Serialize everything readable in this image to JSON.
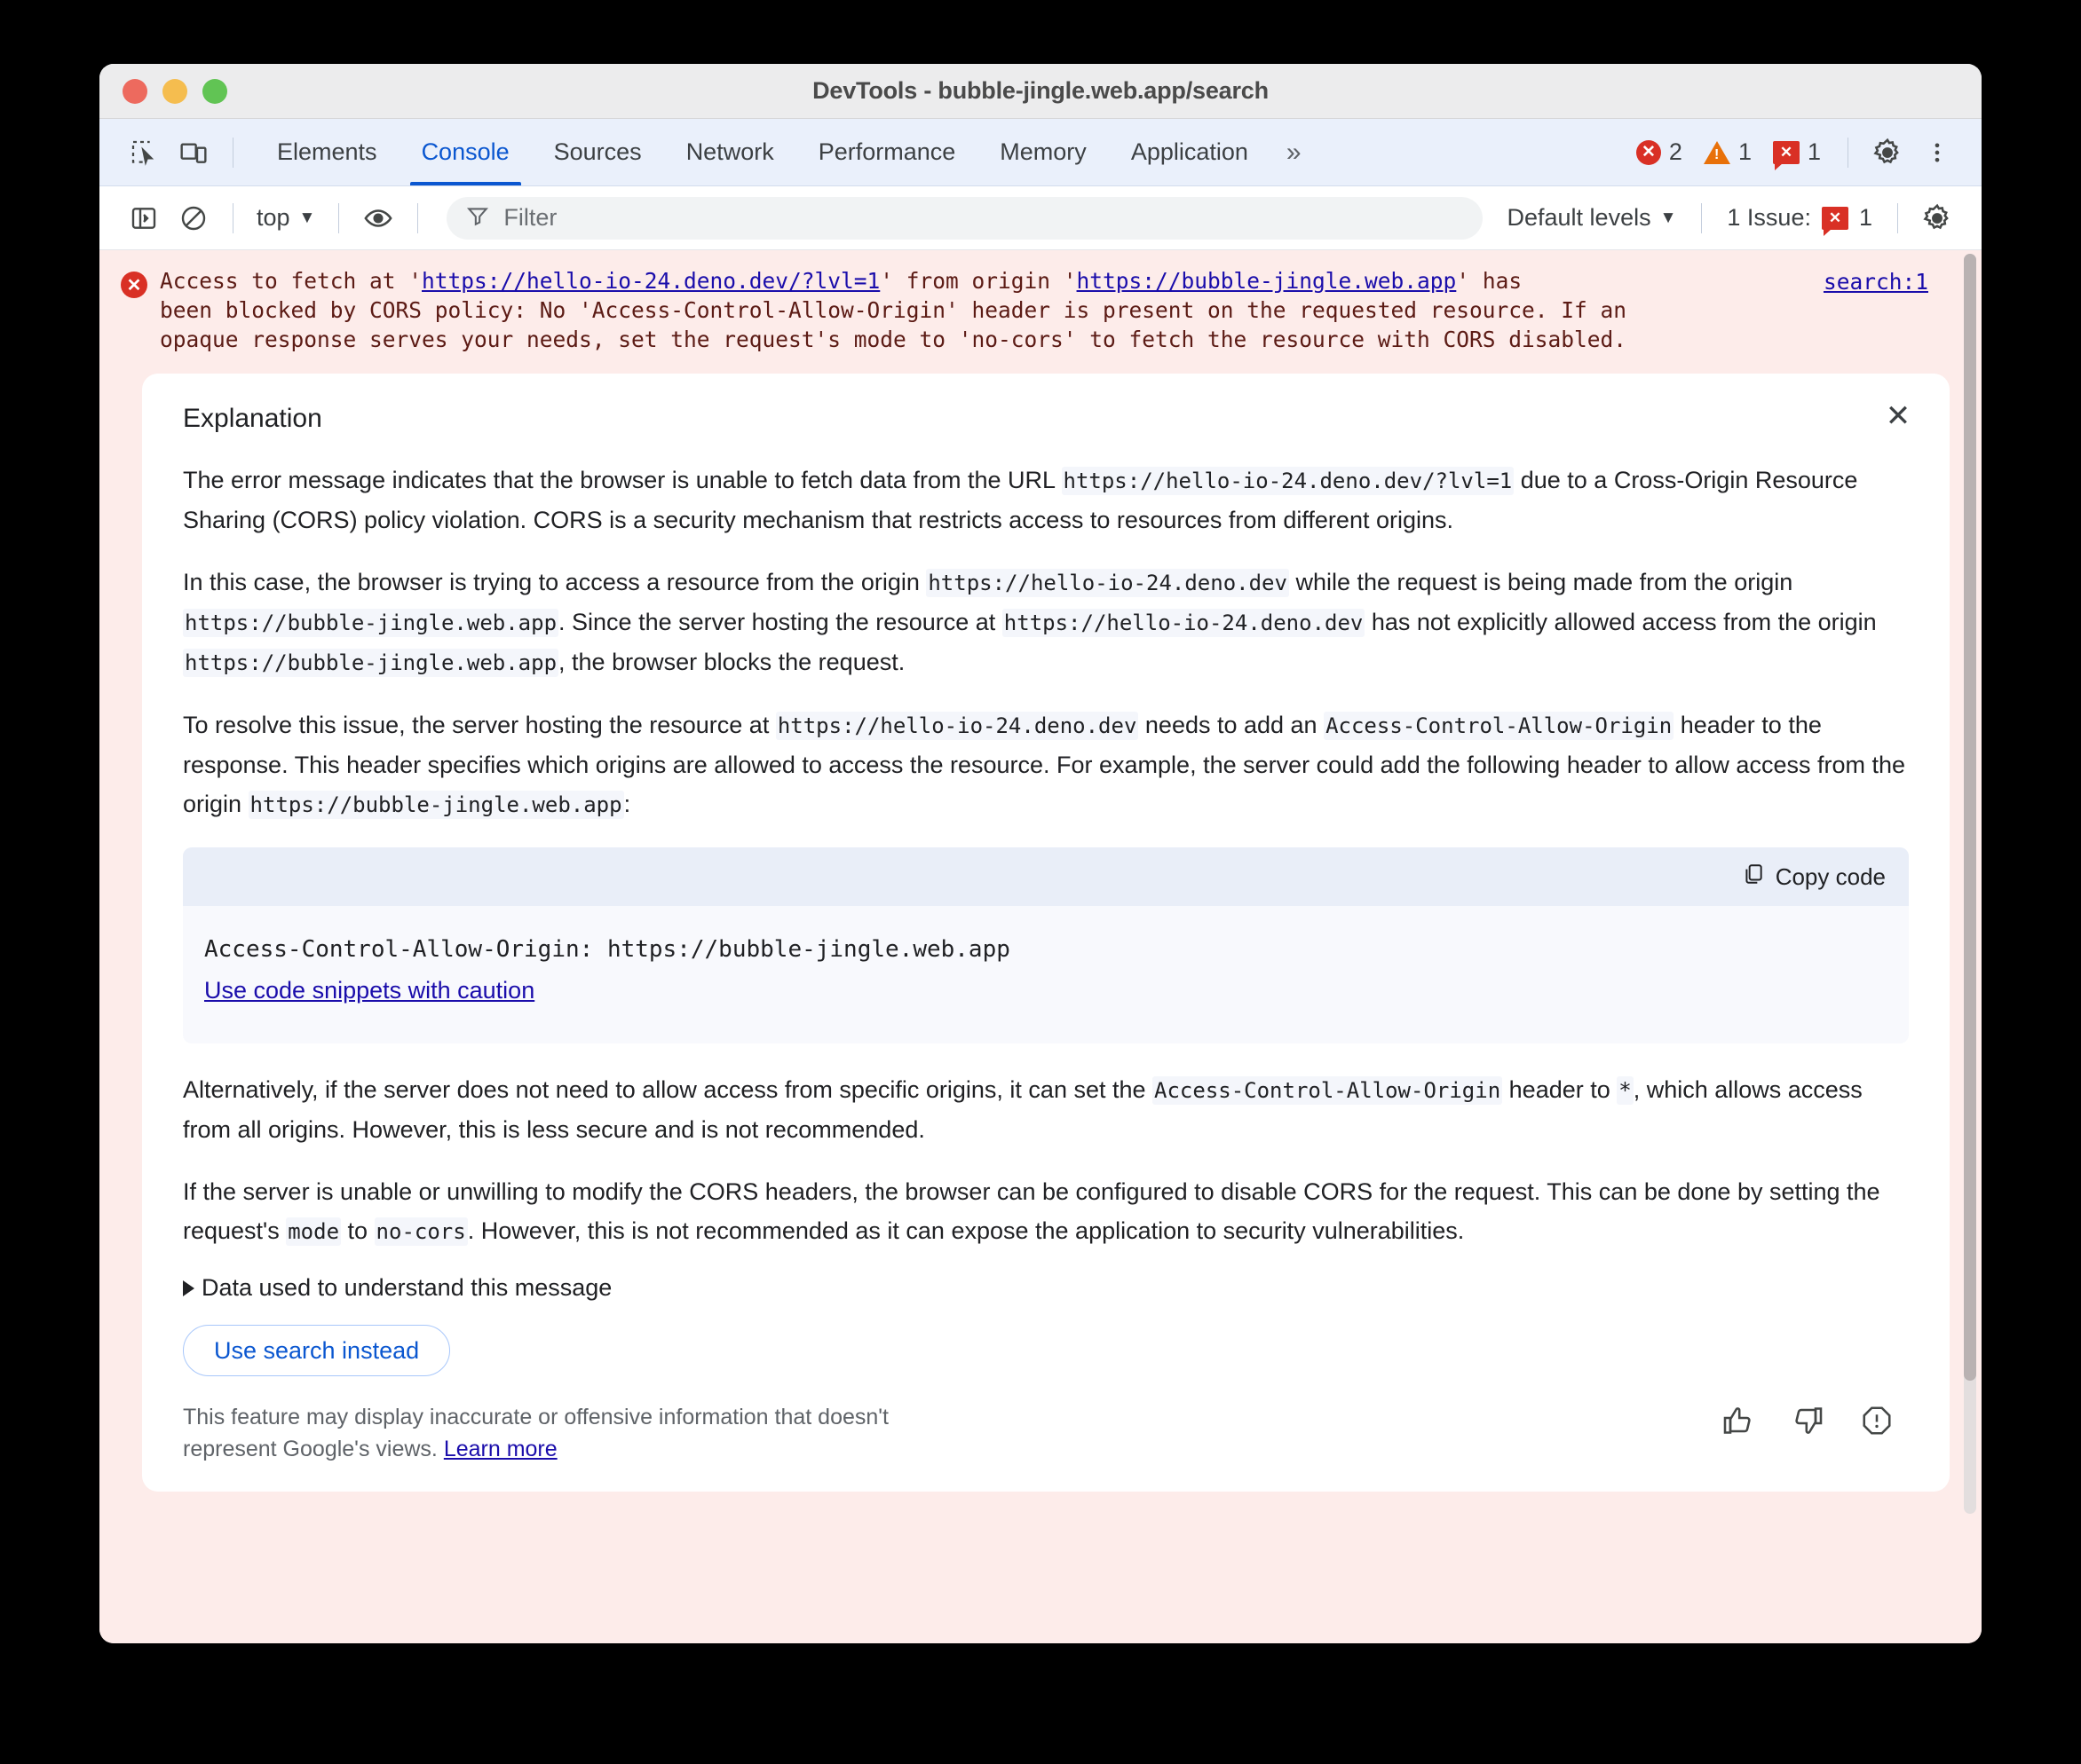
{
  "window": {
    "title": "DevTools - bubble-jingle.web.app/search",
    "traffic_lights": [
      "close",
      "minimize",
      "maximize"
    ]
  },
  "tabbar": {
    "inspect_icon": "inspect-element-icon",
    "device_icon": "device-toolbar-icon",
    "tabs": [
      {
        "label": "Elements",
        "active": false
      },
      {
        "label": "Console",
        "active": true
      },
      {
        "label": "Sources",
        "active": false
      },
      {
        "label": "Network",
        "active": false
      },
      {
        "label": "Performance",
        "active": false
      },
      {
        "label": "Memory",
        "active": false
      },
      {
        "label": "Application",
        "active": false
      }
    ],
    "more_tabs": "»",
    "counters": {
      "errors": "2",
      "warnings": "1",
      "issues": "1",
      "error_glyph": "✕",
      "warning_glyph": "!",
      "issue_glyph": "✕"
    },
    "settings_icon": "gear-icon",
    "menu_icon": "kebab-menu-icon"
  },
  "console_toolbar": {
    "sidebar_icon": "console-sidebar-icon",
    "clear_icon": "clear-console-icon",
    "context": "top",
    "context_caret": "▼",
    "eye_icon": "live-expression-icon",
    "filter_icon": "filter-icon",
    "filter_placeholder": "Filter",
    "filter_value": "",
    "levels": "Default levels",
    "levels_caret": "▼",
    "issues_text": "1 Issue:",
    "issues_count": "1",
    "issues_glyph": "✕",
    "settings_icon": "console-settings-gear-icon"
  },
  "console_message": {
    "icon": "error-circle-icon",
    "icon_glyph": "✕",
    "parts": {
      "p1": "Access to fetch at '",
      "link1": "https://hello-io-24.deno.dev/?lvl=1",
      "p2": "' from origin '",
      "link2": "https://bubble-jingle.web.app",
      "p3": "' has",
      "line2": "been blocked by CORS policy: No 'Access-Control-Allow-Origin' header is present on the requested resource. If an",
      "line3": "opaque response serves your needs, set the request's mode to 'no-cors' to fetch the resource with CORS disabled."
    },
    "source_link": "search:1"
  },
  "explanation": {
    "title": "Explanation",
    "close_label": "✕",
    "paragraph1": {
      "a": "The error message indicates that the browser is unable to fetch data from the URL ",
      "code1": "https://hello-io-24.deno.dev/?lvl=1",
      "b": " due to a Cross-Origin Resource Sharing (CORS) policy violation. CORS is a security mechanism that restricts access to resources from different origins."
    },
    "paragraph2": {
      "a": "In this case, the browser is trying to access a resource from the origin ",
      "code1": "https://hello-io-24.deno.dev",
      "b": " while the request is being made from the origin ",
      "code2": "https://bubble-jingle.web.app",
      "c": ". Since the server hosting the resource at ",
      "code3": "https://hello-io-24.deno.dev",
      "d": " has not explicitly allowed access from the origin ",
      "code4": "https://bubble-jingle.web.app",
      "e": ", the browser blocks the request."
    },
    "paragraph3": {
      "a": "To resolve this issue, the server hosting the resource at ",
      "code1": "https://hello-io-24.deno.dev",
      "b": " needs to add an ",
      "code2": "Access-Control-Allow-Origin",
      "c": " header to the response. This header specifies which origins are allowed to access the resource. For example, the server could add the following header to allow access from the origin ",
      "code3": "https://bubble-jingle.web.app",
      "d": ":"
    },
    "code_block": {
      "copy_label": "Copy code",
      "copy_icon": "copy-icon",
      "content": "Access-Control-Allow-Origin: https://bubble-jingle.web.app",
      "caution_link": "Use code snippets with caution"
    },
    "paragraph4": {
      "a": "Alternatively, if the server does not need to allow access from specific origins, it can set the ",
      "code1": "Access-Control-Allow-Origin",
      "b": " header to ",
      "code2": "*",
      "c": ", which allows access from all origins. However, this is less secure and is not recommended."
    },
    "paragraph5": {
      "a": "If the server is unable or unwilling to modify the CORS headers, the browser can be configured to disable CORS for the request. This can be done by setting the request's ",
      "code1": "mode",
      "b": " to ",
      "code2": "no-cors",
      "c": ". However, this is not recommended as it can expose the application to security vulnerabilities."
    },
    "disclosure_label": "Data used to understand this message",
    "disclosure_glyph": "▶",
    "use_search_button": "Use search instead",
    "footer_note_a": "This feature may display inaccurate or offensive information that doesn't represent Google's views. ",
    "footer_note_link": "Learn more",
    "feedback_icons": {
      "up": "thumb-up-icon",
      "down": "thumb-down-icon",
      "report": "report-icon"
    }
  },
  "colors": {
    "accent": "#0b57d0",
    "error": "#d93025",
    "warning": "#e8710a",
    "link": "#1a0dab",
    "error_bg": "#fdecea",
    "tabbar_bg": "#eaf0fb"
  }
}
